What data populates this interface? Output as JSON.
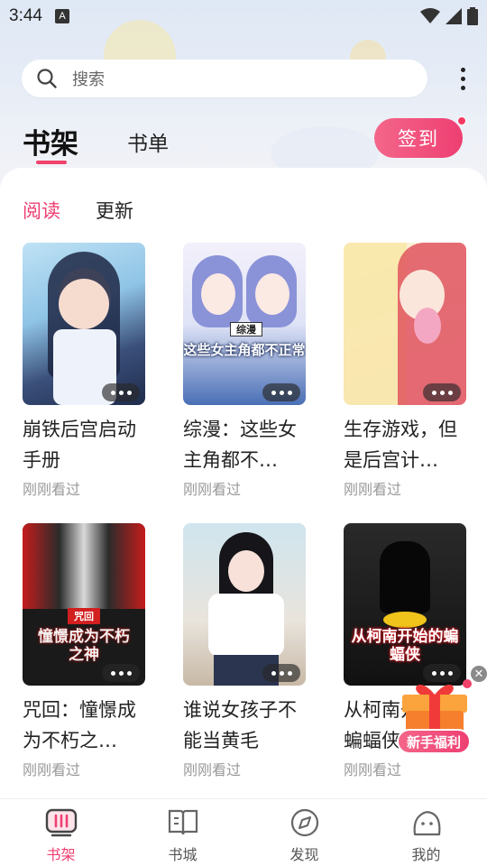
{
  "status_bar": {
    "time": "3:44",
    "notification_glyph": "A"
  },
  "search": {
    "placeholder": "搜索"
  },
  "tabs": {
    "bookshelf": "书架",
    "booklist": "书单"
  },
  "checkin_label": "签到",
  "sub_tabs": {
    "reading": "阅读",
    "updated": "更新"
  },
  "colors": {
    "accent": "#EE3F72",
    "muted": "#999999"
  },
  "books": [
    {
      "title": "崩铁后宫启动手册",
      "status": "刚刚看过",
      "cover_text": ""
    },
    {
      "title": "综漫：这些女主角都不…",
      "status": "刚刚看过",
      "cover_text": "这些女主角都不正常",
      "cover_tag": "综漫"
    },
    {
      "title": "生存游戏，但是后宫计…",
      "status": "刚刚看过",
      "cover_text": ""
    },
    {
      "title": "咒回：憧憬成为不朽之…",
      "status": "刚刚看过",
      "cover_text": "憧憬成为不朽之神",
      "cover_tag": "咒回"
    },
    {
      "title": "谁说女孩子不能当黄毛",
      "status": "刚刚看过",
      "cover_text": ""
    },
    {
      "title": "从柯南开始的蝙蝠侠",
      "status": "刚刚看过",
      "cover_text": "从柯南开始的蝙蝠侠"
    }
  ],
  "gift": {
    "label": "新手福利"
  },
  "bottom_nav": [
    {
      "label": "书架",
      "icon": "bookshelf-icon"
    },
    {
      "label": "书城",
      "icon": "bookstore-icon"
    },
    {
      "label": "发现",
      "icon": "compass-icon"
    },
    {
      "label": "我的",
      "icon": "profile-icon"
    }
  ]
}
